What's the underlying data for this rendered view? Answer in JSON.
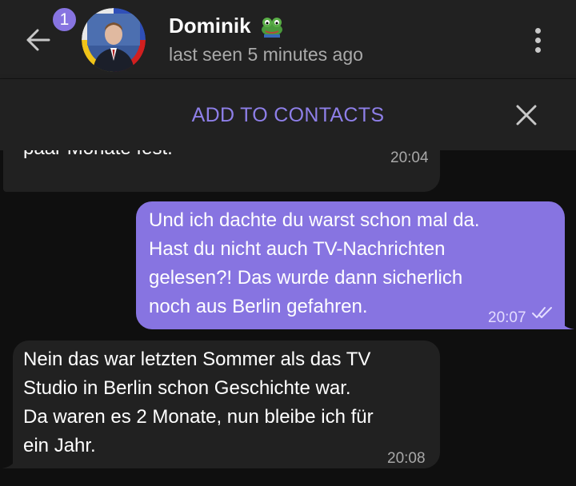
{
  "header": {
    "back_icon": "arrow-left-icon",
    "unread_count": "1",
    "contact_name": "Dominik",
    "name_emoji_icon": "frog-emoji-icon",
    "status": "last seen 5 minutes ago",
    "menu_icon": "more-vertical-icon"
  },
  "add_bar": {
    "label": "ADD TO CONTACTS",
    "close_icon": "close-icon"
  },
  "messages": [
    {
      "direction": "incoming",
      "text": "paar Monate fest.",
      "time": "20:04"
    },
    {
      "direction": "outgoing",
      "text": "Und ich dachte du warst schon mal da.\nHast du nicht auch TV-Nachrichten\ngelesen?! Das wurde dann sicherlich\nnoch aus Berlin gefahren.",
      "time": "20:07",
      "read_icon": "double-check-icon"
    },
    {
      "direction": "incoming",
      "text": "Nein das war letzten Sommer als das TV\nStudio in Berlin schon Geschichte war.\nDa waren es 2 Monate, nun bleibe ich für\nein Jahr.",
      "time": "20:08"
    }
  ],
  "colors": {
    "accent": "#8774e1",
    "header_bg": "#212121",
    "chat_bg": "#0f0f0f",
    "incoming_bubble": "#212121",
    "outgoing_bubble": "#8774e1"
  }
}
